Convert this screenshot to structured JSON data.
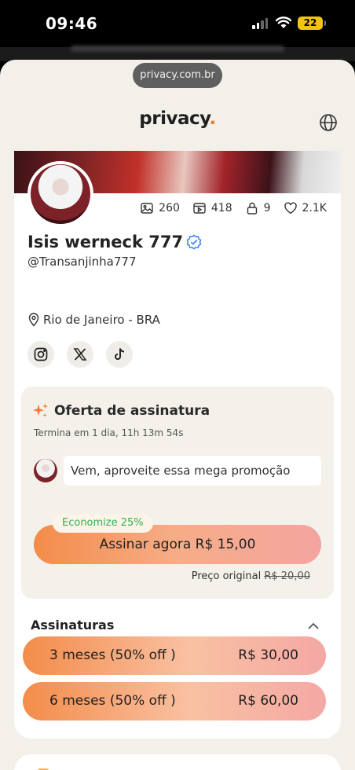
{
  "status_bar": {
    "time": "09:46",
    "battery": "22"
  },
  "browser": {
    "url": "privacy.com.br"
  },
  "header": {
    "logo": "privacy",
    "logo_dot": "."
  },
  "profile": {
    "name": "Isis werneck 777",
    "handle": "@Transanjinha777",
    "location": "Rio de Janeiro - BRA",
    "stats": {
      "photos": "260",
      "videos": "418",
      "locked": "9",
      "likes": "2.1K"
    },
    "socials": [
      "instagram-icon",
      "x-icon",
      "tiktok-icon"
    ]
  },
  "offer": {
    "title": "Oferta de assinatura",
    "countdown": "Termina em 1 dia, 11h 13m 54s",
    "message": "Vem, aproveite essa mega promoção",
    "discount_badge": "Economize 25%",
    "cta_label": "Assinar agora R$ 15,00",
    "original_label": "Preço original",
    "original_price": "R$ 20,00"
  },
  "subscriptions": {
    "title": "Assinaturas",
    "plans": [
      {
        "label": "3 meses (50% off )",
        "price": "R$ 30,00"
      },
      {
        "label": "6 meses (50% off )",
        "price": "R$ 60,00"
      }
    ]
  },
  "colors": {
    "accent": "#f47b2a",
    "success": "#2eb34f",
    "verified": "#3b82f6"
  }
}
